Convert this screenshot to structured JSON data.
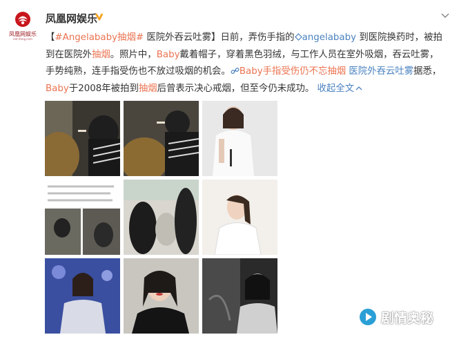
{
  "post": {
    "author": "凤凰网娱乐",
    "avatar_brand": "凤凰网娱乐",
    "avatar_url_text": "ent.ifeng.com",
    "verified_icon": "verified-badge-icon",
    "menu_icon": "chevron-down-icon",
    "text": {
      "l1_open": "【",
      "l1_tag": "#Angelababy抽烟#",
      "l1_rest": " 医院外吞云吐雾】日前，弄伤手指的",
      "l1_mention": "angelababy",
      "l1_tail": " 到医院换药时，被拍",
      "l2_a": "到在医院外",
      "l2_hl1": "抽烟",
      "l2_b": "。照片中，",
      "l2_hl2": "Baby",
      "l2_c": "戴着帽子，穿着黑色羽绒，与工作人员在室外吸烟，吞云吐雾，",
      "l3_a": "手势纯熟，连手指受伤也不放过吸烟的机会。",
      "l3_link": "Baby手指受伤仍不忘抽烟",
      "l3_topic": " 医院外吞云吐雾",
      "l3_b": "据悉，",
      "l4_hl": "Baby",
      "l4_a": "于2008年被拍到",
      "l4_hl2": "抽烟",
      "l4_b": "后曾表示决心戒烟，但至今仍未成功。",
      "collapse": "收起全文"
    }
  },
  "watermark": {
    "text": "剧情奥秘",
    "icon": "play-logo-icon"
  },
  "colors": {
    "highlight": "#eb7350",
    "link_blue": "#4a82c0",
    "brand_red": "#c8161d"
  }
}
